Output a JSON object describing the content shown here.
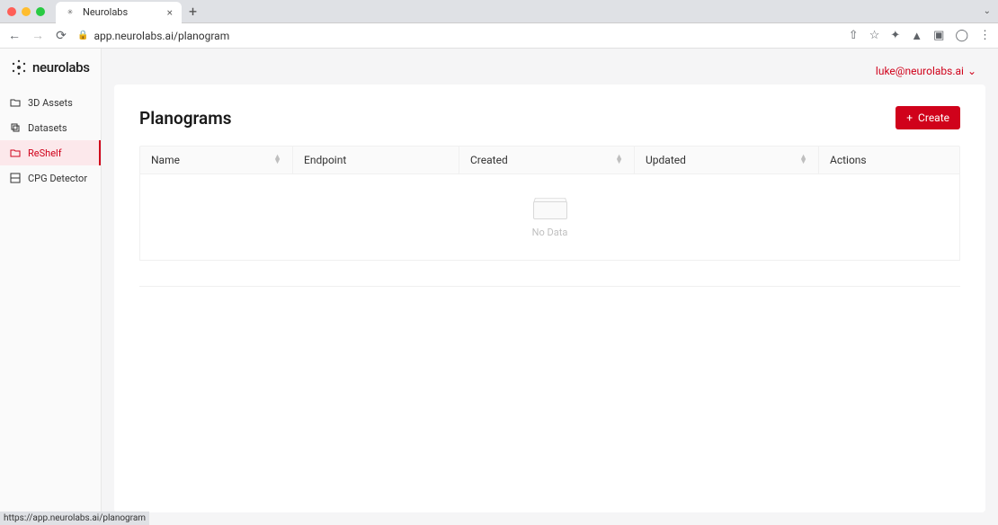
{
  "browser": {
    "tab_title": "Neurolabs",
    "url": "app.neurolabs.ai/planogram"
  },
  "brand": {
    "name": "neurolabs",
    "accent": "#d0021b"
  },
  "user": {
    "email": "luke@neurolabs.ai"
  },
  "sidebar": {
    "items": [
      {
        "label": "3D Assets",
        "icon": "folder"
      },
      {
        "label": "Datasets",
        "icon": "copy"
      },
      {
        "label": "ReShelf",
        "icon": "folder",
        "active": true
      },
      {
        "label": "CPG Detector",
        "icon": "scan"
      }
    ]
  },
  "page": {
    "title": "Planograms",
    "create_label": "Create"
  },
  "table": {
    "columns": {
      "name": "Name",
      "endpoint": "Endpoint",
      "created": "Created",
      "updated": "Updated",
      "actions": "Actions"
    },
    "empty_text": "No Data"
  },
  "status_bar": "https://app.neurolabs.ai/planogram"
}
